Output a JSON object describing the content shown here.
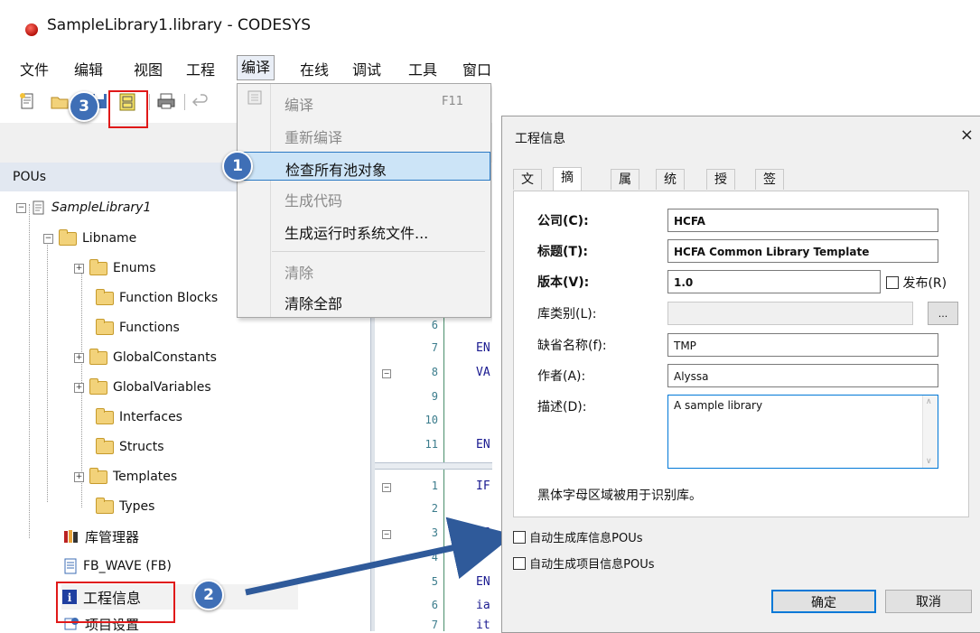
{
  "window": {
    "title": "SampleLibrary1.library - CODESYS"
  },
  "menubar": {
    "items": [
      "文件",
      "编辑",
      "视图",
      "工程",
      "编译",
      "在线",
      "调试",
      "工具",
      "窗口"
    ]
  },
  "dropdown": {
    "items": [
      {
        "label": "编译",
        "shortcut": "F11",
        "disabled": true
      },
      {
        "label": "重新编译",
        "disabled": true
      },
      {
        "label": "检查所有池对象",
        "disabled": false,
        "highlighted": true
      },
      {
        "label": "生成代码",
        "disabled": true
      },
      {
        "label": "生成运行时系统文件...",
        "disabled": false
      },
      {
        "label": "清除",
        "disabled": true
      },
      {
        "label": "清除全部",
        "disabled": false
      }
    ]
  },
  "pous": {
    "header": "POUs",
    "tree": [
      {
        "label": "SampleLibrary1",
        "icon": "library-project-icon",
        "italic": true
      },
      {
        "label": "Libname",
        "icon": "folder-icon"
      },
      {
        "label": "Enums",
        "icon": "folder-icon"
      },
      {
        "label": "Function Blocks",
        "icon": "folder-icon"
      },
      {
        "label": "Functions",
        "icon": "folder-icon"
      },
      {
        "label": "GlobalConstants",
        "icon": "folder-icon"
      },
      {
        "label": "GlobalVariables",
        "icon": "folder-icon"
      },
      {
        "label": "Interfaces",
        "icon": "folder-icon"
      },
      {
        "label": "Structs",
        "icon": "folder-icon"
      },
      {
        "label": "Templates",
        "icon": "folder-icon"
      },
      {
        "label": "Types",
        "icon": "folder-icon"
      },
      {
        "label": "库管理器",
        "icon": "library-manager-icon"
      },
      {
        "label": "FB_WAVE (FB)",
        "icon": "document-icon"
      },
      {
        "label": "工程信息",
        "icon": "info-icon"
      },
      {
        "label": "项目设置",
        "icon": "settings-icon"
      }
    ]
  },
  "code": {
    "lines": [
      {
        "n": "6",
        "text": ""
      },
      {
        "n": "7",
        "text": "EN"
      },
      {
        "n": "8",
        "text": "VA"
      },
      {
        "n": "9",
        "text": ""
      },
      {
        "n": "10",
        "text": ""
      },
      {
        "n": "11",
        "text": "EN"
      }
    ],
    "lines2": [
      {
        "n": "1",
        "text": "IF"
      },
      {
        "n": "2",
        "text": ""
      },
      {
        "n": "3",
        "text": "EI"
      },
      {
        "n": "4",
        "text": ""
      },
      {
        "n": "5",
        "text": "EN"
      },
      {
        "n": "6",
        "text": "ia"
      },
      {
        "n": "7",
        "text": "it"
      }
    ]
  },
  "badges": {
    "b1": "1",
    "b2": "2",
    "b3": "3"
  },
  "dialog": {
    "title": "工程信息",
    "close": "×",
    "tabs": [
      "文件",
      "摘要",
      "属性",
      "统计",
      "授权",
      "签名"
    ],
    "active_tab": "摘要",
    "fields": {
      "company": {
        "label": "公司(C):",
        "value": "HCFA"
      },
      "title": {
        "label": "标题(T):",
        "value": "HCFA Common Library Template"
      },
      "version": {
        "label": "版本(V):",
        "value": "1.0"
      },
      "release": {
        "label": "发布(R)"
      },
      "category": {
        "label": "库类别(L):",
        "value": ""
      },
      "category_btn": "...",
      "default_ns": {
        "label": "缺省名称(f):",
        "value": "TMP"
      },
      "author": {
        "label": "作者(A):",
        "value": "Alyssa"
      },
      "description": {
        "label": "描述(D):",
        "value": "A sample library"
      }
    },
    "note": "黑体字母区域被用于识别库。",
    "checkbox1": "自动生成库信息POUs",
    "checkbox2": "自动生成项目信息POUs",
    "ok": "确定",
    "cancel": "取消"
  },
  "colors": {
    "accent": "#3f6fb6",
    "highlight_box": "#e01919",
    "arrow": "#2f5a9a"
  }
}
